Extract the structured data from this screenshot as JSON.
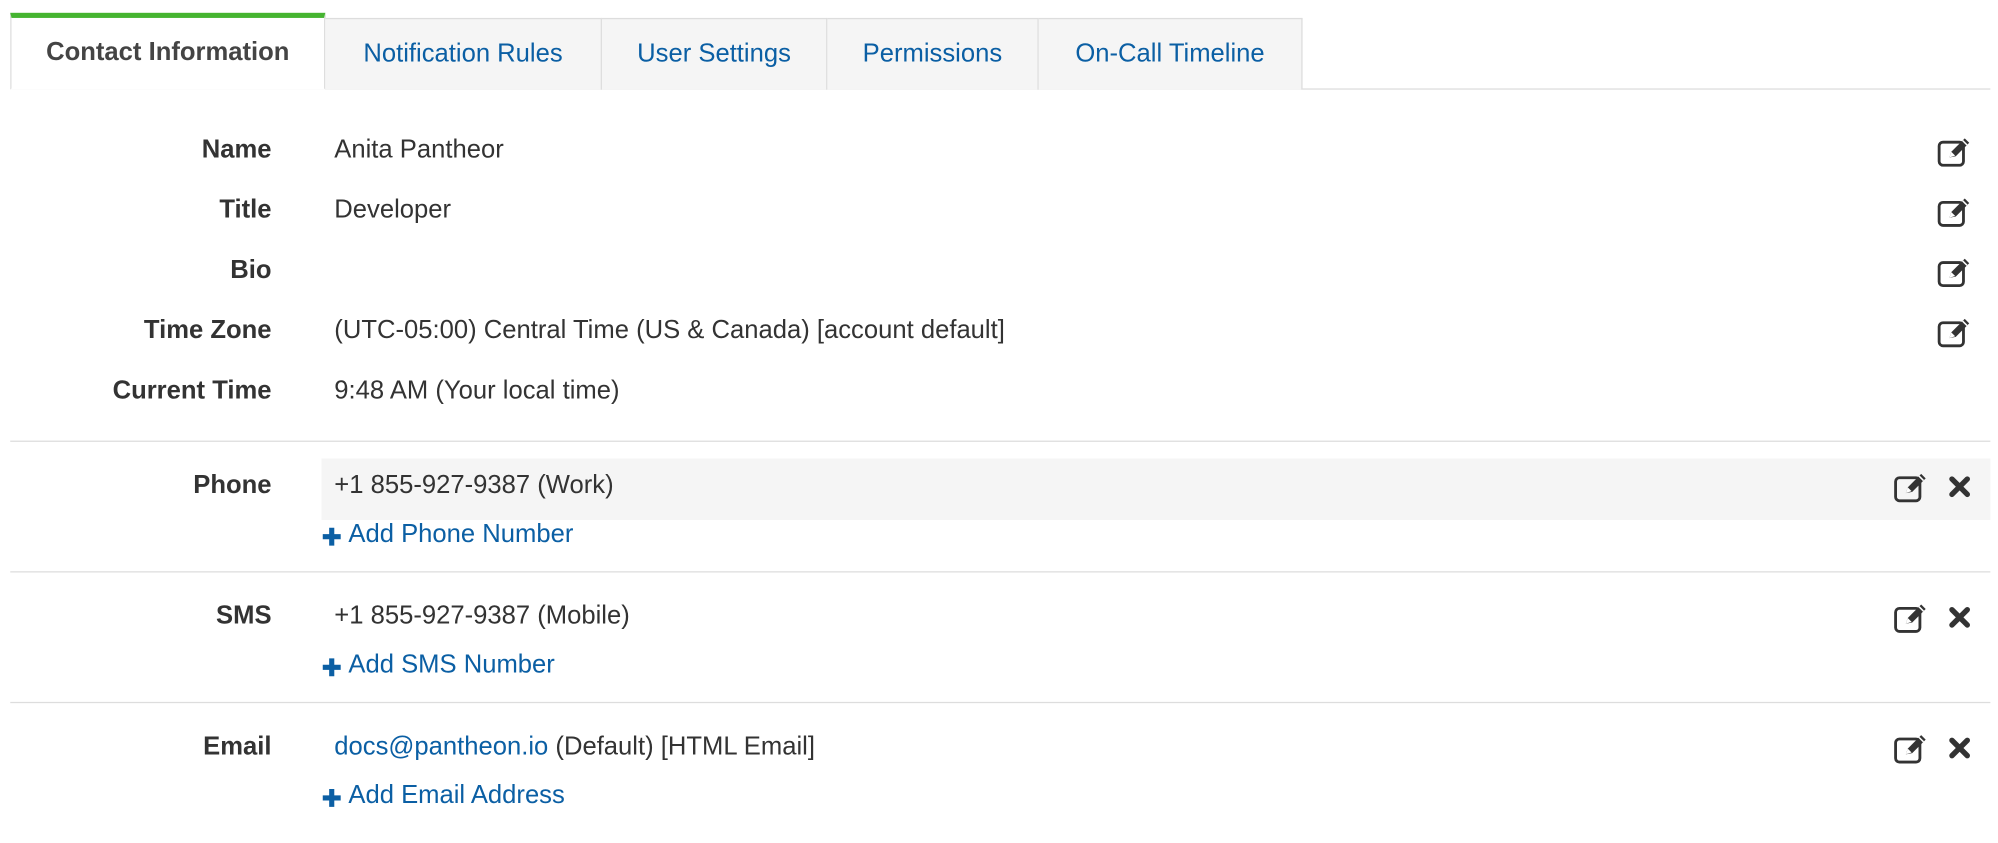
{
  "tabs": [
    {
      "label": "Contact Information"
    },
    {
      "label": "Notification Rules"
    },
    {
      "label": "User Settings"
    },
    {
      "label": "Permissions"
    },
    {
      "label": "On-Call Timeline"
    }
  ],
  "profile": {
    "name": {
      "label": "Name",
      "value": "Anita Pantheor"
    },
    "title": {
      "label": "Title",
      "value": "Developer"
    },
    "bio": {
      "label": "Bio",
      "value": ""
    },
    "timezone": {
      "label": "Time Zone",
      "value": "(UTC-05:00) Central Time (US & Canada) [account default]"
    },
    "current_time": {
      "label": "Current Time",
      "value": "9:48 AM (Your local time)"
    }
  },
  "phone": {
    "label": "Phone",
    "value": "+1 855-927-9387 (Work)",
    "add_label": "Add Phone Number"
  },
  "sms": {
    "label": "SMS",
    "value": "+1 855-927-9387 (Mobile)",
    "add_label": "Add SMS Number"
  },
  "email": {
    "label": "Email",
    "address": "docs@pantheon.io",
    "suffix": " (Default) [HTML Email]",
    "add_label": "Add Email Address"
  },
  "colors": {
    "accent": "#45b430",
    "link": "#0b5fa4"
  }
}
